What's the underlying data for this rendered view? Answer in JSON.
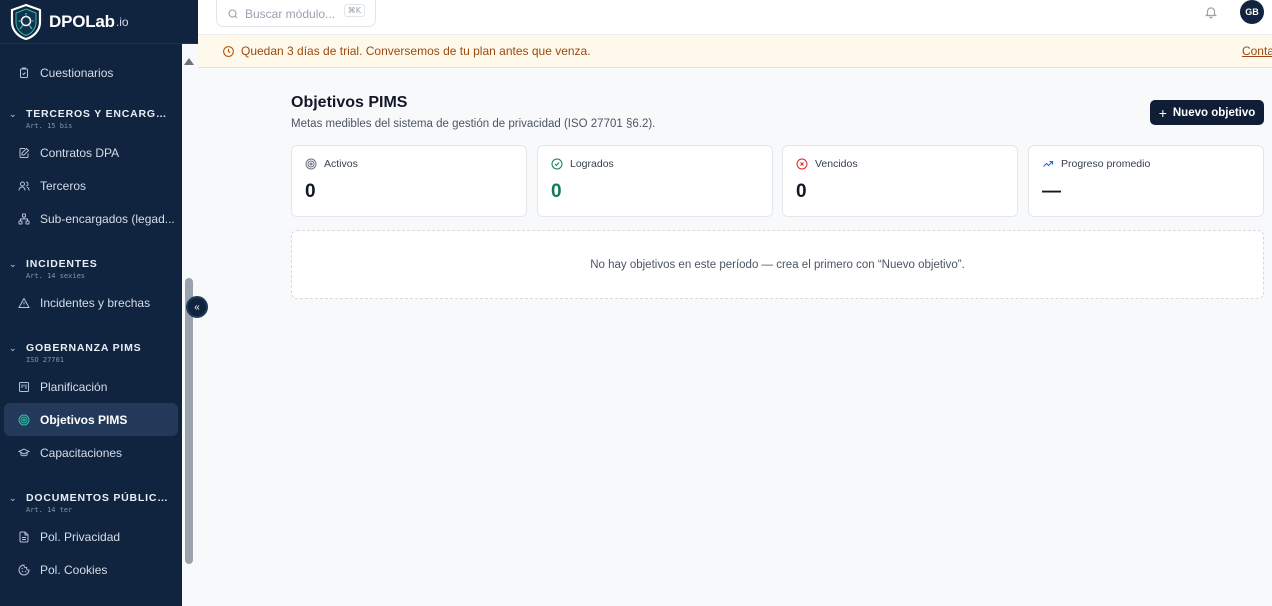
{
  "brand": {
    "name": "DPOLab",
    "suffix": ".io"
  },
  "sidebar": {
    "top_item": {
      "label": "Cuestionarios",
      "icon": "clipboard-icon"
    },
    "sections": [
      {
        "title": "TERCEROS Y ENCARGAD...",
        "sub": "Art. 15 bis",
        "items": [
          {
            "label": "Contratos DPA",
            "icon": "file-edit-icon"
          },
          {
            "label": "Terceros",
            "icon": "users-icon"
          },
          {
            "label": "Sub-encargados (legad...",
            "icon": "network-icon"
          }
        ]
      },
      {
        "title": "INCIDENTES",
        "sub": "Art. 14 sexies",
        "items": [
          {
            "label": "Incidentes y brechas",
            "icon": "warning-icon"
          }
        ]
      },
      {
        "title": "GOBERNANZA PIMS",
        "sub": "ISO 27701",
        "items": [
          {
            "label": "Planificación",
            "icon": "kanban-icon"
          },
          {
            "label": "Objetivos PIMS",
            "icon": "target-icon",
            "active": true
          },
          {
            "label": "Capacitaciones",
            "icon": "graduation-cap-icon"
          }
        ]
      },
      {
        "title": "DOCUMENTOS PÚBLICOS",
        "sub": "Art. 14 ter",
        "items": [
          {
            "label": "Pol. Privacidad",
            "icon": "document-icon"
          },
          {
            "label": "Pol. Cookies",
            "icon": "cookie-icon"
          }
        ]
      }
    ]
  },
  "topbar": {
    "search_placeholder": "Buscar módulo...",
    "search_shortcut": "⌘K",
    "avatar_initials": "GB"
  },
  "banner": {
    "text": "Quedan 3 días de trial. Conversemos de tu plan antes que venza.",
    "link": "Conta"
  },
  "main": {
    "title": "Objetivos PIMS",
    "subtitle": "Metas medibles del sistema de gestión de privacidad (ISO 27701 §6.2).",
    "new_button": "Nuevo objetivo",
    "stats": [
      {
        "label": "Activos",
        "value": "0",
        "icon": "target-icon",
        "color": "#6b7280"
      },
      {
        "label": "Logrados",
        "value": "0",
        "icon": "check-circle-icon",
        "color": "#0f7a5c"
      },
      {
        "label": "Vencidos",
        "value": "0",
        "icon": "x-circle-icon",
        "color": "#dc2626"
      },
      {
        "label": "Progreso promedio",
        "value": "—",
        "icon": "trending-up-icon",
        "color": "#2563eb"
      }
    ],
    "empty_message": "No hay objetivos en este período — crea el primero con “Nuevo objetivo”."
  },
  "colors": {
    "sidebar_bg": "#10233f",
    "accent": "#2ec4a6",
    "banner_bg": "#fef9ea",
    "primary_button": "#0f1e36"
  }
}
